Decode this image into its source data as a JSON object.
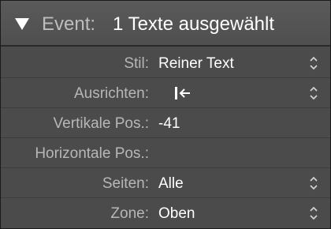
{
  "header": {
    "label": "Event:",
    "value": "1 Texte ausgewählt"
  },
  "fields": {
    "stil": {
      "label": "Stil:",
      "value": "Reiner Text"
    },
    "ausrichten": {
      "label": "Ausrichten:",
      "icon": "align-left-arrow-icon"
    },
    "vertikale": {
      "label": "Vertikale Pos.:",
      "value": "-41"
    },
    "horizontale": {
      "label": "Horizontale Pos.:",
      "value": ""
    },
    "seiten": {
      "label": "Seiten:",
      "value": "Alle"
    },
    "zone": {
      "label": "Zone:",
      "value": "Oben"
    }
  },
  "colors": {
    "panel": "#4b4b4b",
    "header": "#555555",
    "label": "#b7b7b7",
    "value": "#ffffff"
  }
}
